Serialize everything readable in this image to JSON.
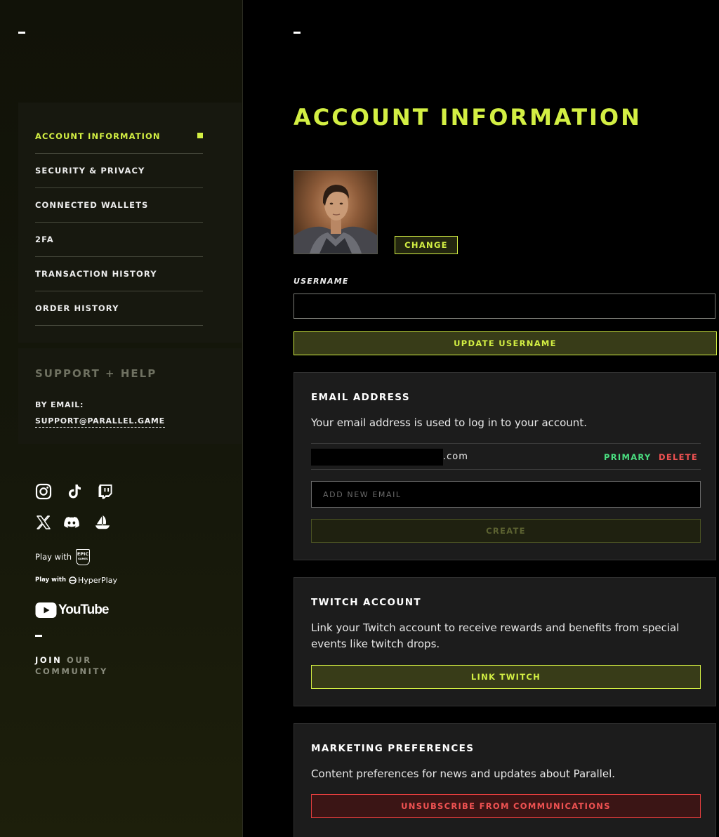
{
  "sidebar": {
    "nav": [
      {
        "label": "ACCOUNT INFORMATION",
        "active": true
      },
      {
        "label": "SECURITY & PRIVACY"
      },
      {
        "label": "CONNECTED WALLETS"
      },
      {
        "label": "2FA"
      },
      {
        "label": "TRANSACTION HISTORY"
      },
      {
        "label": "ORDER HISTORY"
      }
    ],
    "support": {
      "title": "SUPPORT + HELP",
      "by_email": "BY EMAIL:",
      "email": "SUPPORT@PARALLEL.GAME"
    },
    "socials": [
      "instagram-icon",
      "tiktok-icon",
      "twitch-icon",
      "x-icon",
      "discord-icon",
      "opensea-icon"
    ],
    "play_with_epic": {
      "prefix": "Play with",
      "badge_top": "EPIC",
      "badge_bottom": "GAMES"
    },
    "play_with_hyperplay": {
      "prefix": "Play with",
      "brand": "HyperPlay"
    },
    "youtube": "YouTube",
    "join": {
      "word1": "JOIN",
      "word2": "OUR",
      "word3": "COMMUNITY"
    }
  },
  "main": {
    "title": "ACCOUNT INFORMATION",
    "change_label": "CHANGE",
    "username_label": "USERNAME",
    "username_value": "",
    "update_username_label": "UPDATE USERNAME",
    "email": {
      "title": "EMAIL ADDRESS",
      "description": "Your email address is used to log in to your account.",
      "domain": ".com",
      "primary_label": "PRIMARY",
      "delete_label": "DELETE",
      "new_email_placeholder": "ADD NEW EMAIL",
      "create_label": "CREATE"
    },
    "twitch": {
      "title": "TWITCH ACCOUNT",
      "description": "Link your Twitch account to receive rewards and benefits from special events like twitch drops.",
      "link_label": "LINK TWITCH"
    },
    "marketing": {
      "title": "MARKETING PREFERENCES",
      "description": "Content preferences for news and updates about Parallel.",
      "unsubscribe_label": "UNSUBSCRIBE FROM COMMUNICATIONS"
    }
  },
  "colors": {
    "accent": "#d3ef43",
    "primary_status": "#4ade80",
    "danger": "#f05252",
    "card_bg": "#1c1c1c"
  }
}
